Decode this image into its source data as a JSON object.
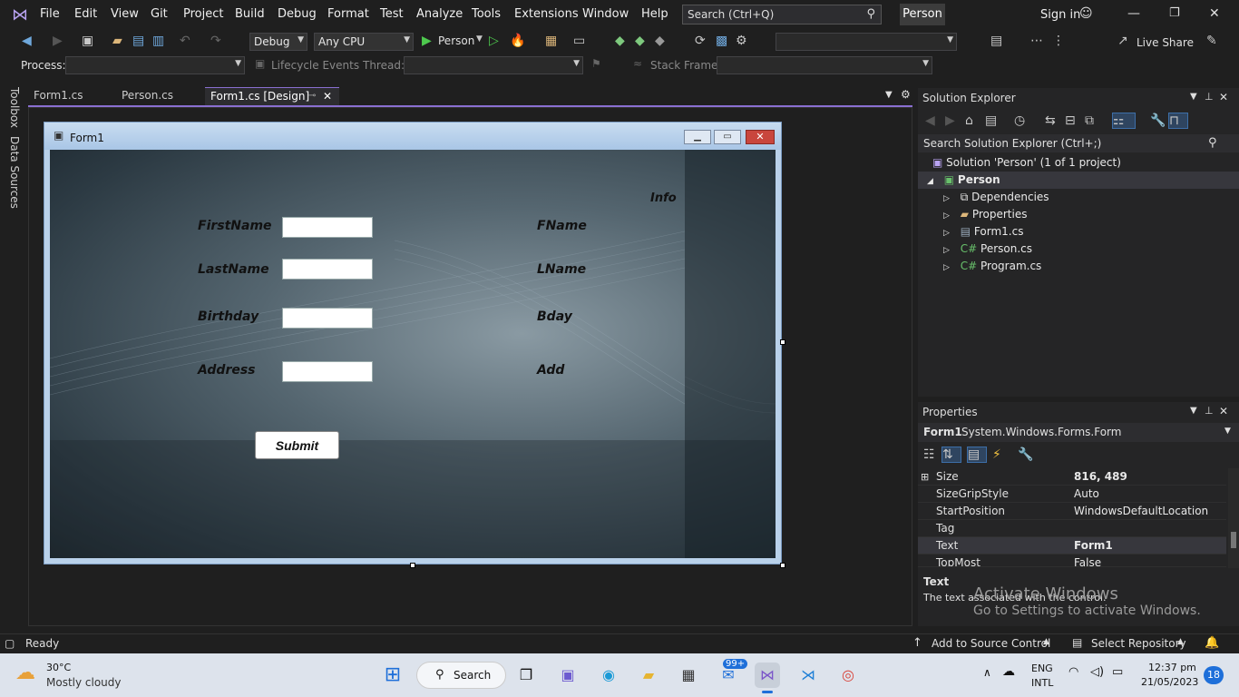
{
  "menu": [
    "File",
    "Edit",
    "View",
    "Git",
    "Project",
    "Build",
    "Debug",
    "Format",
    "Test",
    "Analyze",
    "Tools",
    "Extensions",
    "Window",
    "Help"
  ],
  "search_placeholder": "Search (Ctrl+Q)",
  "project_badge": "Person",
  "sign_in": "Sign in",
  "toolbar": {
    "config": "Debug",
    "platform": "Any CPU",
    "run_target": "Person",
    "live_share": "Live Share"
  },
  "debugbar": {
    "process_label": "Process:",
    "lifecycle_label": "Lifecycle Events",
    "thread_label": "Thread:",
    "stack_label": "Stack Frame:"
  },
  "side_tabs": [
    "Toolbox",
    "Data Sources"
  ],
  "doc_tabs": [
    "Form1.cs",
    "Person.cs",
    "Form1.cs [Design]"
  ],
  "form": {
    "title": "Form1",
    "labels": {
      "firstname": "FirstName",
      "lastname": "LastName",
      "birthday": "Birthday",
      "address": "Address",
      "info": "Info",
      "fname": "FName",
      "lname": "LName",
      "bday": "Bday",
      "add": "Add"
    },
    "submit": "Submit"
  },
  "solution_explorer": {
    "title": "Solution Explorer",
    "search": "Search Solution Explorer (Ctrl+;)",
    "solution": "Solution 'Person' (1 of 1 project)",
    "project": "Person",
    "items": [
      "Dependencies",
      "Properties",
      "Form1.cs",
      "Person.cs",
      "Program.cs"
    ]
  },
  "properties": {
    "title": "Properties",
    "object": "Form1",
    "object_type": "System.Windows.Forms.Form",
    "rows": [
      {
        "key": "Size",
        "value": "816, 489"
      },
      {
        "key": "SizeGripStyle",
        "value": "Auto"
      },
      {
        "key": "StartPosition",
        "value": "WindowsDefaultLocation"
      },
      {
        "key": "Tag",
        "value": ""
      },
      {
        "key": "Text",
        "value": "Form1"
      },
      {
        "key": "TopMost",
        "value": "False"
      }
    ],
    "desc_title": "Text",
    "desc_text": "The text associated with the control."
  },
  "watermark": {
    "line1": "Activate Windows",
    "line2": "Go to Settings to activate Windows."
  },
  "status": {
    "ready": "Ready",
    "source_control": "Add to Source Control",
    "repository": "Select Repository"
  },
  "taskbar": {
    "weather_temp": "30°C",
    "weather_desc": "Mostly cloudy",
    "search": "Search",
    "mail_badge": "99+",
    "lang1": "ENG",
    "lang2": "INTL",
    "time": "12:37 pm",
    "date": "21/05/2023",
    "notif_count": "18"
  }
}
